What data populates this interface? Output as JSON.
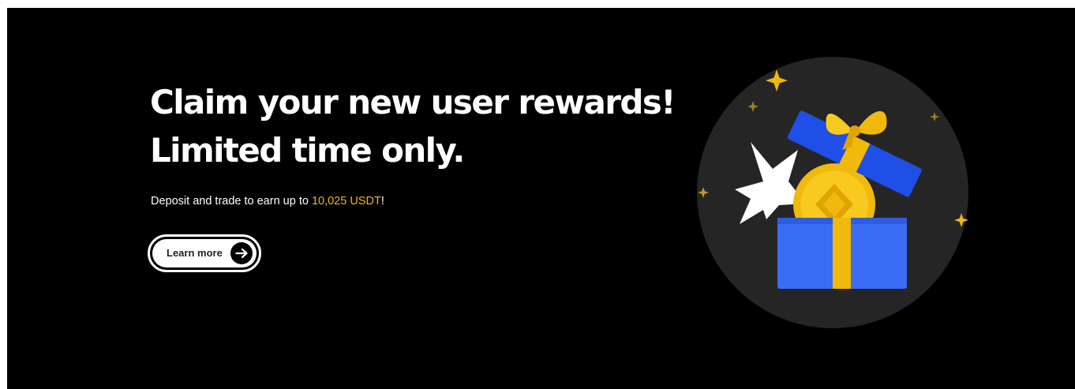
{
  "banner": {
    "headline_line1": "Claim your new user rewards!",
    "headline_line2": "Limited time only.",
    "subtext_before": "Deposit and trade to earn up to ",
    "subtext_amount": "10,025 USDT",
    "subtext_after": "!",
    "cta_label": "Learn more",
    "cta_icon": "arrow-right-icon",
    "illustration": "gift-box-with-coin-icon"
  },
  "colors": {
    "background": "#000000",
    "text": "#ffffff",
    "accent": "#f0b90b",
    "gift_blue": "#3b6cf6",
    "gift_ribbon": "#f0b90b",
    "illustration_circle": "#252525"
  }
}
